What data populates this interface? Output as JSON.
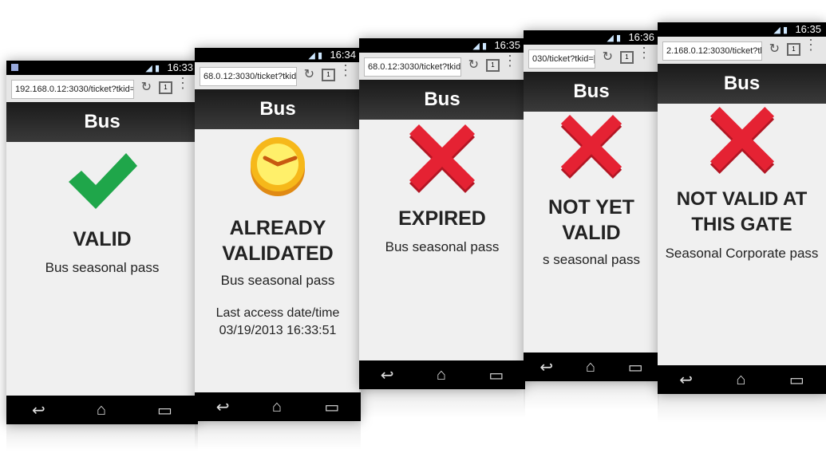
{
  "title": "Bus",
  "nav": {
    "back": "↩",
    "home": "⌂",
    "recent": "▭"
  },
  "phones": [
    {
      "clock": "16:33",
      "url": "192.168.0.12:3030/ticket?tkid=[",
      "headline": "VALID",
      "pass": "Bus seasonal pass",
      "icon": "check-icon"
    },
    {
      "clock": "16:34",
      "url": "68.0.12:3030/ticket?tkid=[",
      "headline": "ALREADY VALIDATED",
      "pass": "Bus seasonal pass",
      "meta_label": "Last access date/time",
      "meta_value": "03/19/2013 16:33:51",
      "icon": "clock-icon"
    },
    {
      "clock": "16:35",
      "url": "68.0.12:3030/ticket?tkid=[",
      "headline": "EXPIRED",
      "pass": "Bus seasonal pass",
      "icon": "x-icon"
    },
    {
      "clock": "16:36",
      "url": "030/ticket?tkid=[",
      "headline": "NOT YET VALID",
      "pass": "s seasonal pass",
      "icon": "x-icon"
    },
    {
      "clock": "16:35",
      "url": "2.168.0.12:3030/ticket?tkid=§",
      "headline": "NOT VALID AT THIS GATE",
      "pass": "Seasonal Corporate pass",
      "icon": "x-icon"
    }
  ],
  "colors": {
    "valid": "#1fa64a",
    "clock": "#f6b81a",
    "invalid": "#e52233"
  }
}
